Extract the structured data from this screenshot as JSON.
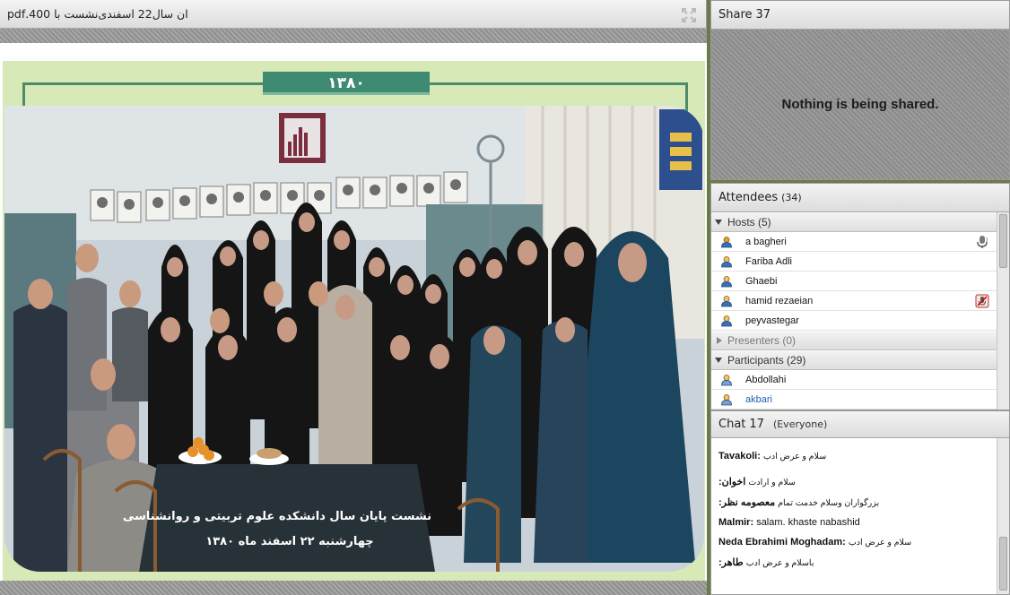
{
  "document_pod": {
    "title": "ان سال22 اسفندی‌نشست با 400.pdf",
    "year_banner": "۱۳۸۰",
    "photo_caption_line1": "نشست پایان سال دانشکده علوم تربیتی و روانشناسی",
    "photo_caption_line2": "چهارشنبه ۲۲ اسفند ماه ۱۳۸۰"
  },
  "share_pod": {
    "title": "Share",
    "count": "37",
    "empty_message": "Nothing is being shared."
  },
  "attendees_pod": {
    "title": "Attendees",
    "count": "(34)",
    "groups": {
      "hosts": {
        "label": "Hosts (5)",
        "members": [
          {
            "name": "a bagheri",
            "status": "microphone-icon"
          },
          {
            "name": "Fariba Adli",
            "status": ""
          },
          {
            "name": "Ghaebi",
            "status": ""
          },
          {
            "name": "hamid rezaeian",
            "status": "microphone-muted-icon"
          },
          {
            "name": "peyvastegar",
            "status": ""
          }
        ]
      },
      "presenters": {
        "label": "Presenters (0)"
      },
      "participants": {
        "label": "Participants (29)",
        "members": [
          {
            "name": "Abdollahi"
          },
          {
            "name": "akbari"
          }
        ]
      }
    }
  },
  "chat_pod": {
    "title": "Chat",
    "count": "17",
    "scope": "(Everyone)",
    "messages": [
      {
        "sender": "Tavakoli:",
        "text": "سلام و عرض ادب"
      },
      {
        "sender": "اخوان:",
        "text": "سلام و ارادت"
      },
      {
        "sender": "معصومه نظر:",
        "text": "بزرگواران وسلام خدمت تمام"
      },
      {
        "sender": "Malmir:",
        "text": "salam. khaste nabashid"
      },
      {
        "sender": "Neda Ebrahimi Moghadam:",
        "text": "سلام و عرض ادب"
      },
      {
        "sender": "طاهر:",
        "text": "باسلام و عرض ادب"
      }
    ]
  },
  "colors": {
    "banner_green": "#3e8b72",
    "page_green": "#d6e9b6",
    "link_blue": "#1f5fb5"
  }
}
